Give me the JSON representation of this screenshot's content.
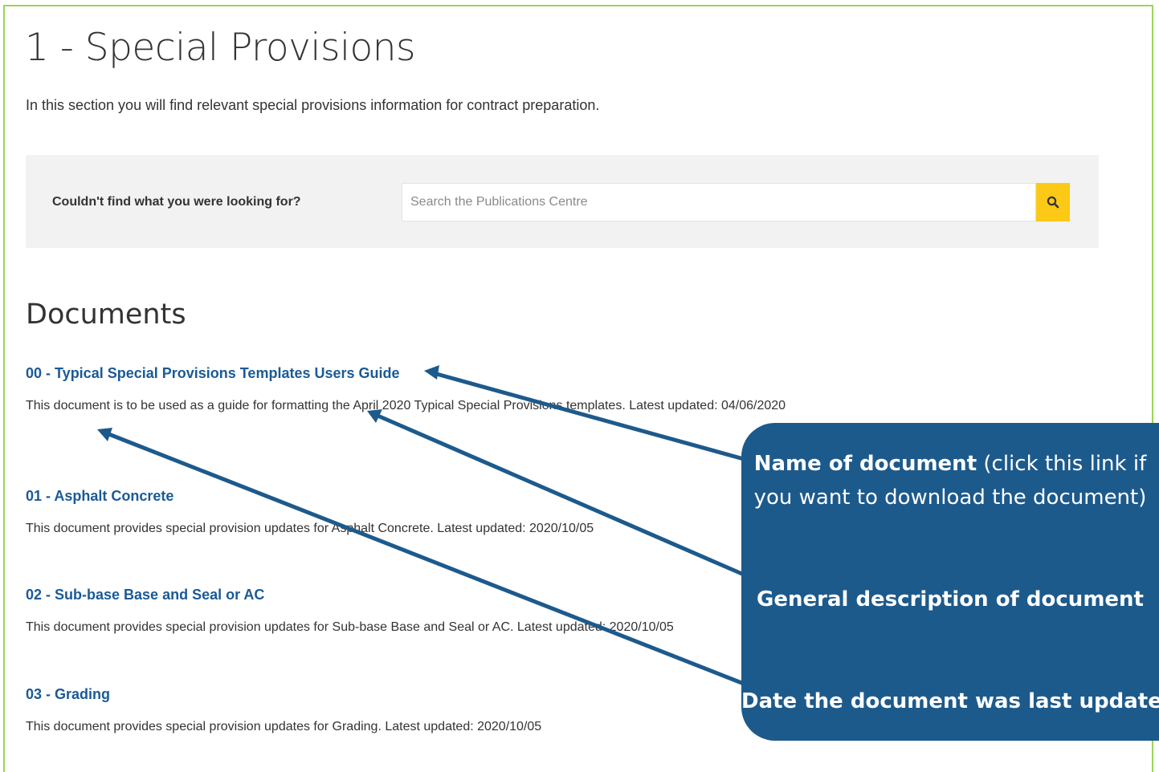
{
  "page": {
    "title": "1 - Special Provisions",
    "intro": "In this section you will find relevant special provisions information for contract preparation."
  },
  "search": {
    "prompt": "Couldn't find what you were looking for?",
    "placeholder": "Search the Publications Centre",
    "button_icon": "search-icon"
  },
  "documents": {
    "heading": "Documents",
    "items": [
      {
        "title": "00 - Typical Special Provisions Templates Users Guide",
        "description": "This document is to be used as a guide for formatting the April 2020 Typical Special Provisions templates. Latest updated: 04/06/2020"
      },
      {
        "title": "01 - Asphalt Concrete",
        "description": "This document provides special provision updates for Asphalt Concrete. Latest updated: 2020/10/05"
      },
      {
        "title": "02 - Sub-base Base and Seal or AC",
        "description": "This document provides special provision updates for Sub-base Base and Seal or AC. Latest updated: 2020/10/05"
      },
      {
        "title": "03 - Grading",
        "description": "This document provides special provision updates for Grading. Latest updated: 2020/10/05"
      }
    ]
  },
  "callout": {
    "name_bold": "Name of document",
    "name_rest": " (click this link if",
    "name_line2": "you want to download the document)",
    "description_label": "General description of document",
    "date_label": "Date the document was last updated"
  },
  "colors": {
    "link": "#1a5a96",
    "search_button": "#fcc917",
    "callout_bg": "#1d5a8c",
    "frame": "#9bd45a",
    "panel_bg": "#f2f2f2"
  }
}
